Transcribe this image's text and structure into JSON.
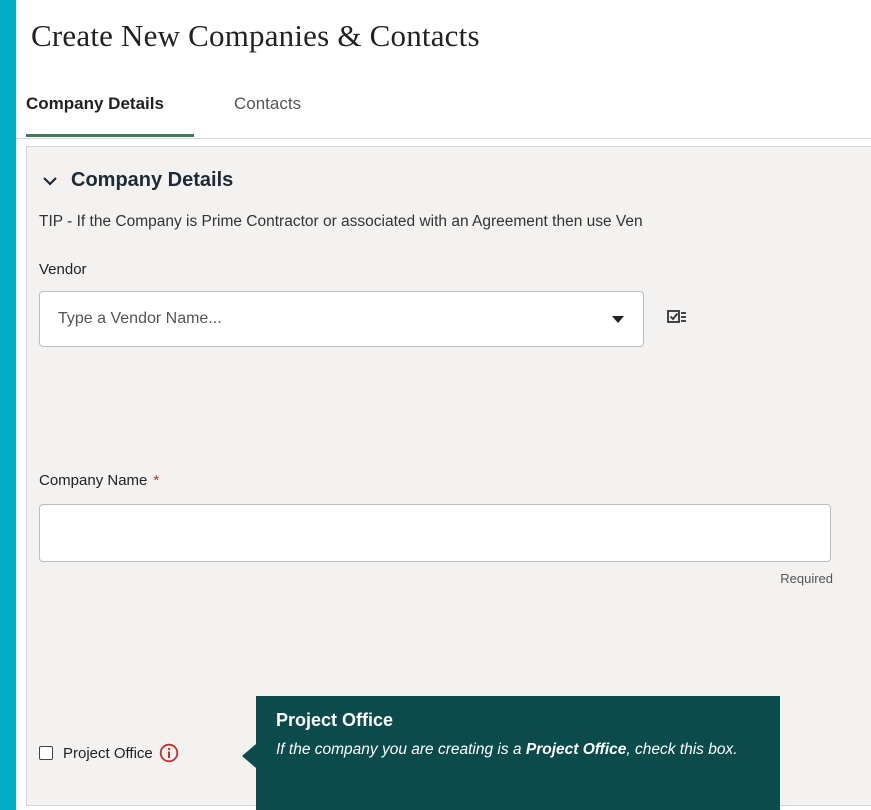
{
  "page": {
    "title": "Create New Companies & Contacts"
  },
  "tabs": [
    {
      "label": "Company Details",
      "active": true
    },
    {
      "label": "Contacts",
      "active": false
    }
  ],
  "section": {
    "title": "Company Details",
    "tip": "TIP - If the Company is Prime Contractor or associated with an Agreement then use Ven"
  },
  "vendor": {
    "label": "Vendor",
    "placeholder": "Type a Vendor Name...",
    "value": ""
  },
  "company_name": {
    "label": "Company Name",
    "required_marker": "*",
    "value": "",
    "hint": "Required"
  },
  "project_office": {
    "label": "Project Office",
    "checked": false
  },
  "tooltip": {
    "title": "Project Office",
    "body_prefix": "If the company you are creating is a ",
    "body_emphasis": "Project Office",
    "body_suffix": ", check this box."
  },
  "colors": {
    "frame": "#00aec8",
    "accent": "#3f7a5a",
    "tooltip_bg": "#0b4b4c",
    "info_icon": "#c0302f"
  }
}
